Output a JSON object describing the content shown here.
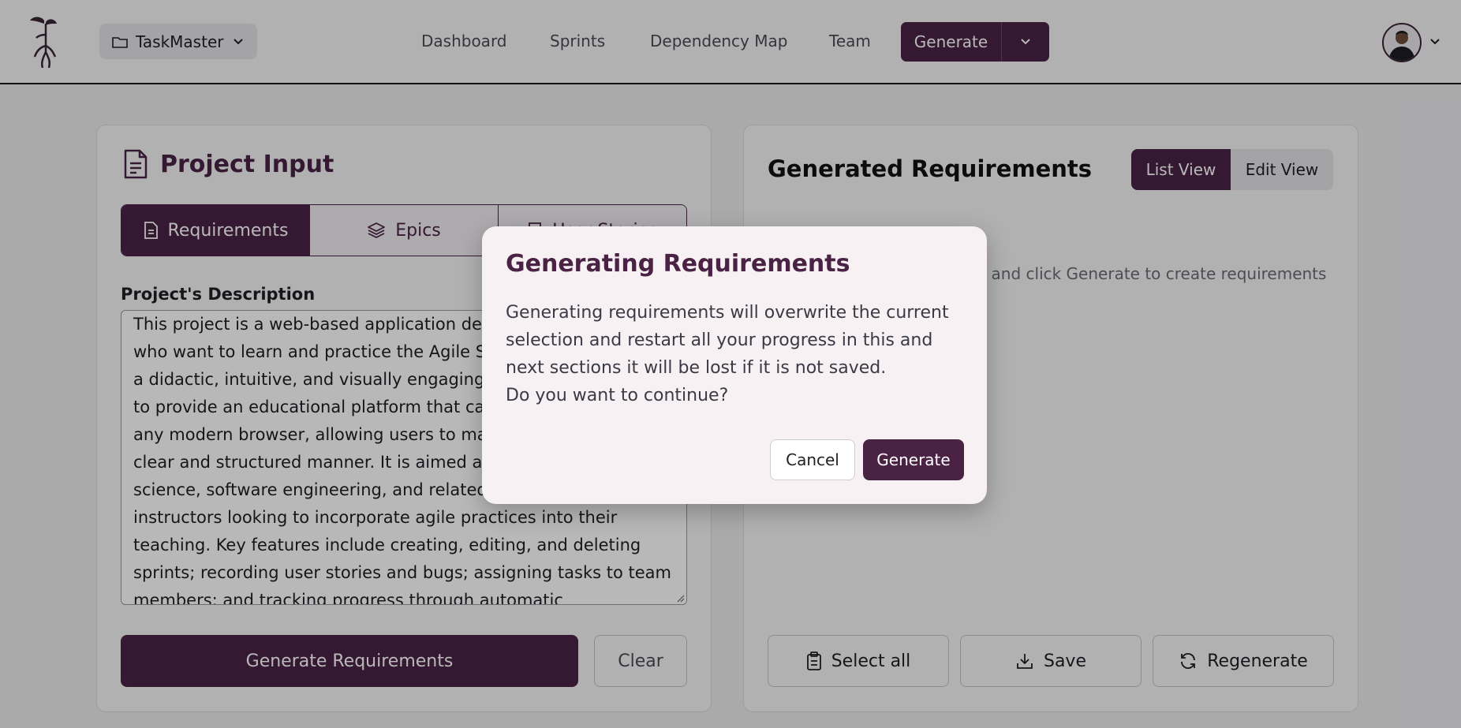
{
  "header": {
    "project_name": "TaskMaster",
    "nav": [
      "Dashboard",
      "Sprints",
      "Dependency Map",
      "Team"
    ],
    "generate_label": "Generate"
  },
  "project_input": {
    "title": "Project Input",
    "tabs": [
      {
        "label": "Requirements",
        "icon": "file-icon",
        "active": true
      },
      {
        "label": "Epics",
        "icon": "layers-icon",
        "active": false
      },
      {
        "label": "User Stories",
        "icon": "book-icon",
        "active": false
      }
    ],
    "description_label": "Project's Description",
    "description": "This project is a web-based application designed for students who want to learn and practice the Agile Scrum methodology in a didactic, intuitive, and visually engaging way. The main goal is to provide an educational platform that can be accessed from any modern browser, allowing users to manage projects in a clear and structured manner. It is aimed at students of computer science, software engineering, and related fields, as well as instructors looking to incorporate agile practices into their teaching. Key features include creating, editing, and deleting sprints; recording user stories and bugs; assigning tasks to team members; and tracking progress through automatic",
    "generate_button": "Generate Requirements",
    "clear_button": "Clear"
  },
  "generated": {
    "title": "Generated Requirements",
    "views": [
      "List View",
      "Edit View"
    ],
    "empty_message": "Enter a project description and click Generate to create requirements",
    "buttons": {
      "select_all": "Select all",
      "save": "Save",
      "regenerate": "Regenerate"
    }
  },
  "modal": {
    "title": "Generating Requirements",
    "message": "Generating requirements will overwrite the current selection and restart all your progress in this and next sections it will be lost if it is not saved.",
    "question": "Do you want to continue?",
    "cancel": "Cancel",
    "confirm": "Generate"
  },
  "colors": {
    "primary": "#4a2244",
    "background": "#ececee",
    "card": "#f7f6f7"
  }
}
